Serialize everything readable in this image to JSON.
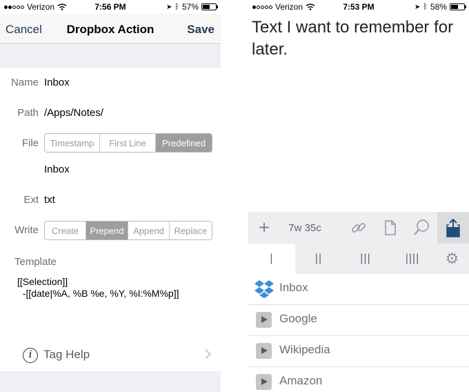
{
  "left_screen": {
    "status": {
      "carrier": "Verizon",
      "time": "7:56 PM",
      "battery": "57%",
      "battery_level": 0.57
    },
    "nav": {
      "cancel": "Cancel",
      "title": "Dropbox Action",
      "save": "Save"
    },
    "name": {
      "label": "Name",
      "value": "Inbox"
    },
    "path": {
      "label": "Path",
      "value": "/Apps/Notes/"
    },
    "file": {
      "label": "File",
      "options": [
        "Timestamp",
        "First Line",
        "Predefined"
      ],
      "selected": "Predefined",
      "value": "Inbox"
    },
    "ext": {
      "label": "Ext",
      "value": "txt"
    },
    "write": {
      "label": "Write",
      "options": [
        "Create",
        "Prepend",
        "Append",
        "Replace"
      ],
      "selected": "Prepend"
    },
    "template": {
      "label": "Template",
      "text": "[[Selection]]\n  -[[date|%A, %B %e, %Y, %I:%M%p]]"
    },
    "tag_help": {
      "label": "Tag Help"
    }
  },
  "right_screen": {
    "status": {
      "carrier": "Verizon",
      "time": "7:53 PM",
      "battery": "58%",
      "battery_level": 0.58
    },
    "note_text": "Text I want to remember for later.",
    "toolbar": {
      "count": "7w 35c"
    },
    "columns": [
      "|",
      "||",
      "|||",
      "||||"
    ],
    "actions": [
      {
        "label": "Inbox",
        "icon": "dropbox-icon"
      },
      {
        "label": "Google",
        "icon": "play-icon"
      },
      {
        "label": "Wikipedia",
        "icon": "play-icon"
      },
      {
        "label": "Amazon",
        "icon": "play-icon"
      }
    ]
  }
}
